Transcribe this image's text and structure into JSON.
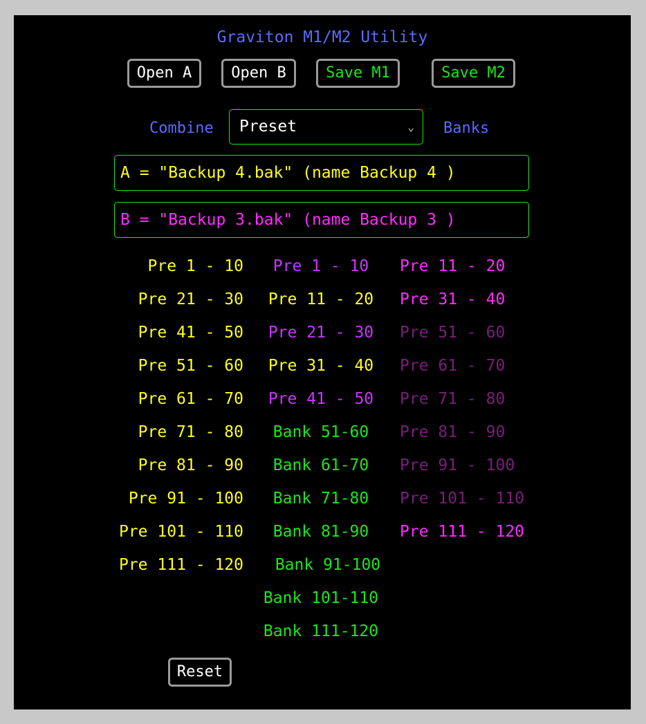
{
  "app_title": "Graviton M1/M2 Utility",
  "toolbar": {
    "open_a": "Open A",
    "open_b": "Open B",
    "save_m1": "Save M1",
    "save_m2": "Save M2"
  },
  "combine": {
    "left_label": "Combine",
    "selected": "Preset",
    "right_label": "Banks"
  },
  "files": {
    "a": "A = \"Backup 4.bak\" (name Backup 4 )",
    "b": "B = \"Backup 3.bak\" (name Backup 3 )"
  },
  "column_a": [
    "Pre 1 - 10",
    "Pre 21 - 30",
    "Pre 41 - 50",
    "Pre 51 - 60",
    "Pre 61 - 70",
    "Pre 71 - 80",
    "Pre 81 - 90",
    "Pre 91 - 100",
    "Pre 101 - 110",
    "Pre 111 - 120"
  ],
  "column_b": [
    "Pre 1 - 10",
    "Pre 11 - 20",
    "Pre 21 - 30",
    "Pre 31 - 40",
    "Pre 41 - 50",
    "Bank 51-60",
    "Bank 61-70",
    "Bank 71-80",
    "Bank 81-90",
    "Bank 91-100",
    "Bank 101-110",
    "Bank 111-120"
  ],
  "column_c": [
    "Pre 11 - 20",
    "Pre 31 - 40",
    "Pre 51 - 60",
    "Pre 61 - 70",
    "Pre 71 - 80",
    "Pre 81 - 90",
    "Pre 91 - 100",
    "Pre 101 - 110",
    "Pre 111 - 120"
  ],
  "reset_label": "Reset",
  "colors": {
    "title_blue": "#5a6bff",
    "file_a_yellow": "#ffff1e",
    "file_b_magenta": "#ff2cff",
    "bank_green": "#1ce61c",
    "violet": "#cc33ff",
    "dim_magenta": "#7a1e7a"
  }
}
